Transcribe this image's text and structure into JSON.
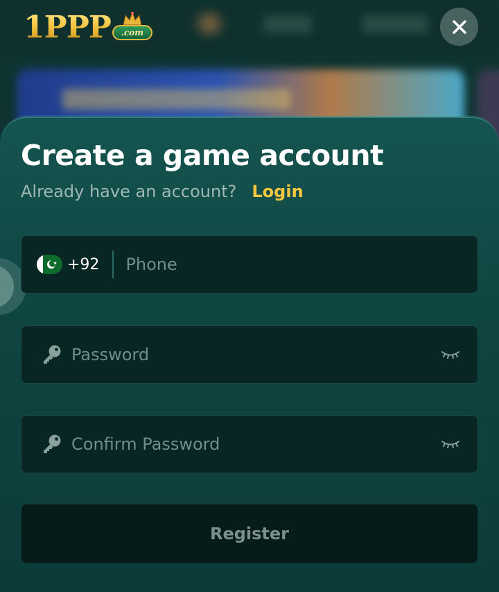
{
  "app": {
    "logo_text": "1PPP",
    "logo_suffix": ".com"
  },
  "modal": {
    "title": "Create a game account",
    "subtitle": "Already have an account?",
    "login_link": "Login",
    "phone": {
      "country_code": "+92",
      "country_flag": "pakistan-flag",
      "placeholder": "Phone",
      "value": ""
    },
    "password": {
      "placeholder": "Password",
      "value": ""
    },
    "confirm_password": {
      "placeholder": "Confirm Password",
      "value": ""
    },
    "register_label": "Register"
  },
  "icons": {
    "close": "close-icon",
    "key": "key-icon",
    "eye": "eye-closed-icon"
  },
  "colors": {
    "accent": "#f5c73e",
    "sheet": "#155450",
    "field": "#082624",
    "button": "#061c1b"
  }
}
